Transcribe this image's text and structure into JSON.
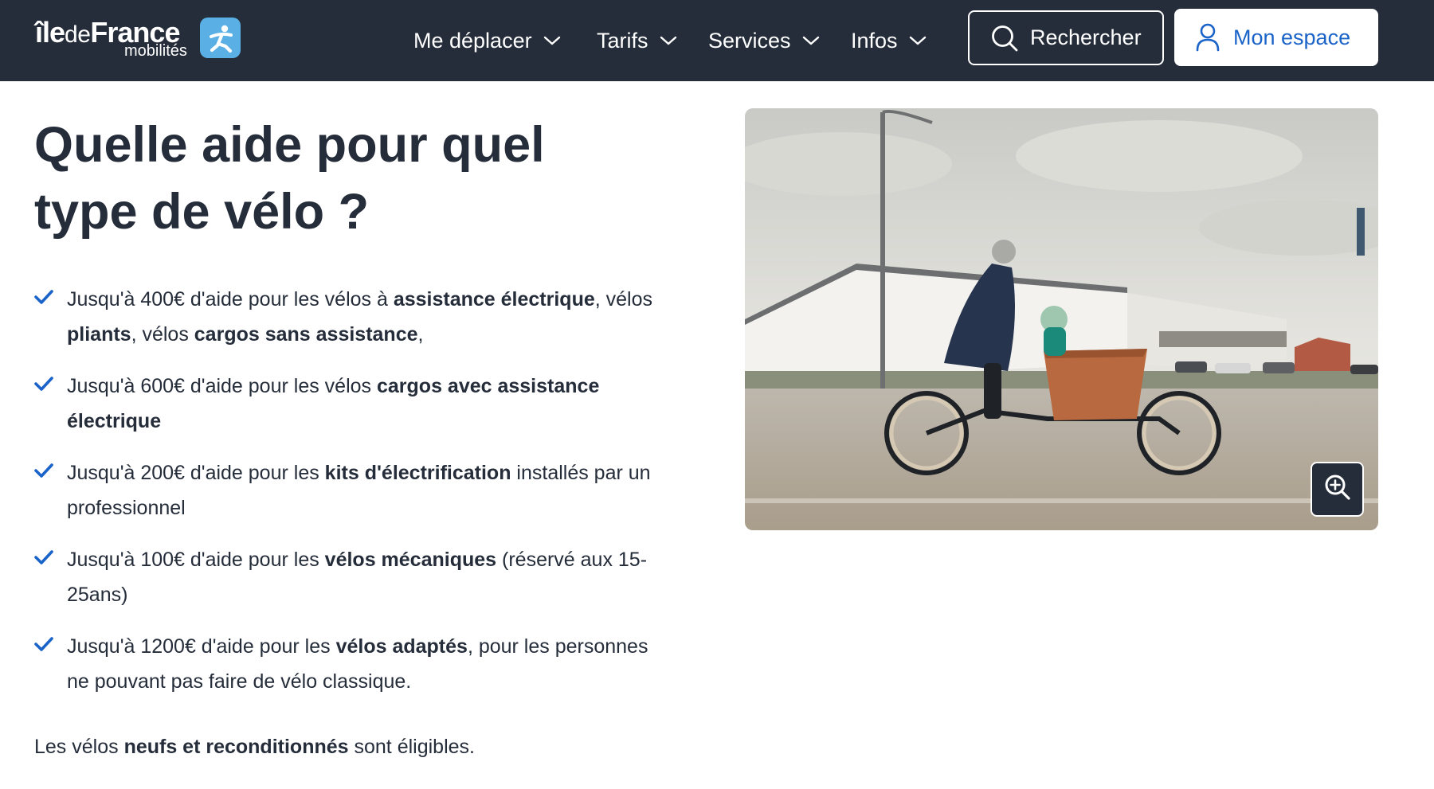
{
  "header": {
    "logo": {
      "part1": "île",
      "part2": "de",
      "part3": "France",
      "sub": "mobilités"
    },
    "nav": [
      {
        "label": "Me déplacer"
      },
      {
        "label": "Tarifs"
      },
      {
        "label": "Services"
      },
      {
        "label": "Infos"
      }
    ],
    "search_label": "Rechercher",
    "account_label": "Mon espace"
  },
  "content": {
    "title_line1": "Quelle aide pour quel",
    "title_line2": "type de vélo ?",
    "aids": [
      {
        "a": "Jusqu'à 400€ d'aide pour les vélos à ",
        "b1": "assistance électrique",
        "c": ", vélos ",
        "b2": "pliants",
        "d": ", vélos ",
        "b3": "cargos sans assistance",
        "e": ","
      },
      {
        "a": "Jusqu'à 600€ d'aide pour les vélos ",
        "b1": "cargos avec assistance électrique"
      },
      {
        "a": "Jusqu'à 200€ d'aide pour les ",
        "b1": "kits d'électrification",
        "c": " installés par un professionnel"
      },
      {
        "a": "Jusqu'à 100€ d'aide pour les ",
        "b1": "vélos mécaniques",
        "c": " (réservé aux 15-25ans)"
      },
      {
        "a": "Jusqu'à 1200€ d'aide pour les ",
        "b1": "vélos adaptés",
        "c": ", pour les personnes ne pouvant pas faire de vélo classique."
      }
    ],
    "note_a": "Les vélos ",
    "note_b": "neufs et reconditionnés",
    "note_c": " sont éligibles."
  },
  "colors": {
    "header_bg": "#252d3a",
    "accent_blue": "#1a63c9",
    "logo_badge": "#5ab0e5",
    "text": "#252d3a"
  },
  "icons": {
    "nav_chevron": "chevron-down-icon",
    "search": "search-icon",
    "account": "user-icon",
    "check": "check-icon",
    "zoom": "zoom-in-icon"
  }
}
